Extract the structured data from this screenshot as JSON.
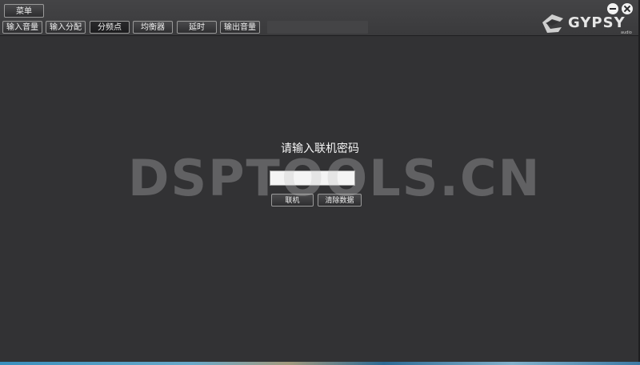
{
  "menu": {
    "label": "菜单"
  },
  "tabs": [
    {
      "label": "输入音量"
    },
    {
      "label": "输入分配"
    },
    {
      "label": "分频点"
    },
    {
      "label": "均衡器"
    },
    {
      "label": "延时"
    },
    {
      "label": "输出音量"
    }
  ],
  "active_tab_index": 2,
  "logo": {
    "text": "GYPSY",
    "subtext": "audio"
  },
  "dialog": {
    "prompt": "请输入联机密码",
    "password_value": "",
    "connect_label": "联机",
    "clear_label": "清除数据"
  },
  "watermark": "DSPTOOLS.CN",
  "colors": {
    "background": "#323234",
    "topbar": "#3f3f41",
    "text": "#f4f4f4"
  }
}
